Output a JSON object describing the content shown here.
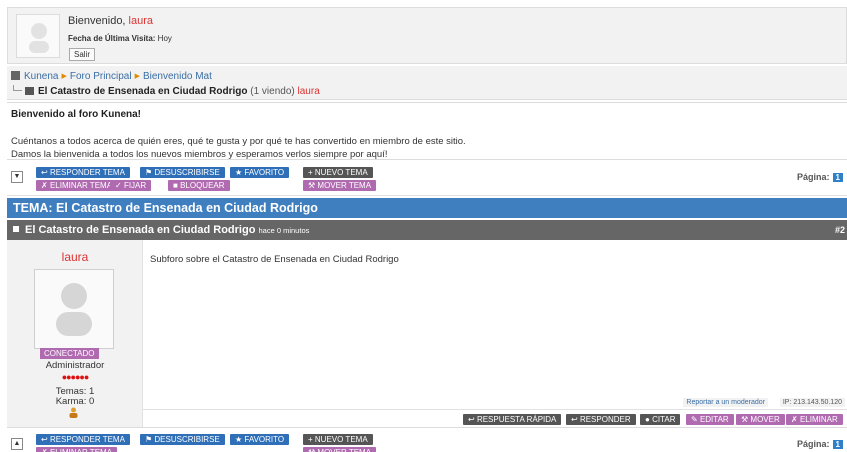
{
  "user_box": {
    "welcome_prefix": "Bienvenido, ",
    "username": "laura",
    "last_visit_label": "Fecha de Última Visita:",
    "last_visit_value": "Hoy",
    "logout_label": "Salir"
  },
  "breadcrumb": {
    "items": [
      "Kunena",
      "Foro Principal",
      "Bienvenido Mat"
    ],
    "topic": "El Catastro de Ensenada en Ciudad Rodrigo",
    "viewing": "(1 viendo)",
    "viewer": "laura"
  },
  "announcement": {
    "title": "Bienvenido al foro Kunena!",
    "line1": "Cuéntanos a todos acerca de quién eres, qué te gusta y por qué te has convertido en miembro de este sitio.",
    "line2": "Damos la bienvenida a todos los nuevos miembros y esperamos verlos siempre por aquí!"
  },
  "toolbar": {
    "reply": "RESPONDER TEMA",
    "unsubscribe": "DESUSCRIBIRSE",
    "favorite": "FAVORITO",
    "delete": "ELIMINAR TEMA",
    "sticky": "FIJAR",
    "lock": "BLOQUEAR",
    "new_topic": "NUEVO TEMA",
    "move": "MOVER TEMA",
    "page_label": "Página:",
    "page": "1"
  },
  "topic": {
    "header": "TEMA: El Catastro de Ensenada en Ciudad Rodrigo"
  },
  "message": {
    "subject": "El Catastro de Ensenada en Ciudad Rodrigo",
    "ago": "hace 0 minutos",
    "number": "#2",
    "body": "Subforo sobre el Catastro de Ensenada en Ciudad Rodrigo",
    "report": "Reportar a un moderador",
    "ip": "IP: 213.143.50.120"
  },
  "profile": {
    "name": "laura",
    "status": "CONECTADO",
    "rank": "Administrador",
    "rank_dots": "●●●●●●",
    "posts": "Temas: 1",
    "karma": "Karma: 0"
  },
  "post_actions": {
    "quick_reply": "RESPUESTA RÁPIDA",
    "reply": "RESPONDER",
    "quote": "CITAR",
    "edit": "EDITAR",
    "move": "MOVER",
    "delete": "ELIMINAR"
  },
  "icons": {
    "reply": "↩",
    "flag": "⚑",
    "star": "★",
    "x": "✗",
    "check": "✓",
    "lock": "🔒",
    "plus": "+",
    "wrench": "🔧",
    "quote": "●",
    "pencil": "✎",
    "collapse_down": "▼",
    "collapse_up": "▲"
  },
  "colors": {
    "accent_blue": "#3f7fc0",
    "button_blue": "#2f6fb8",
    "button_pink": "#b06ab0",
    "button_gray": "#555555",
    "username_red": "#d33333"
  }
}
